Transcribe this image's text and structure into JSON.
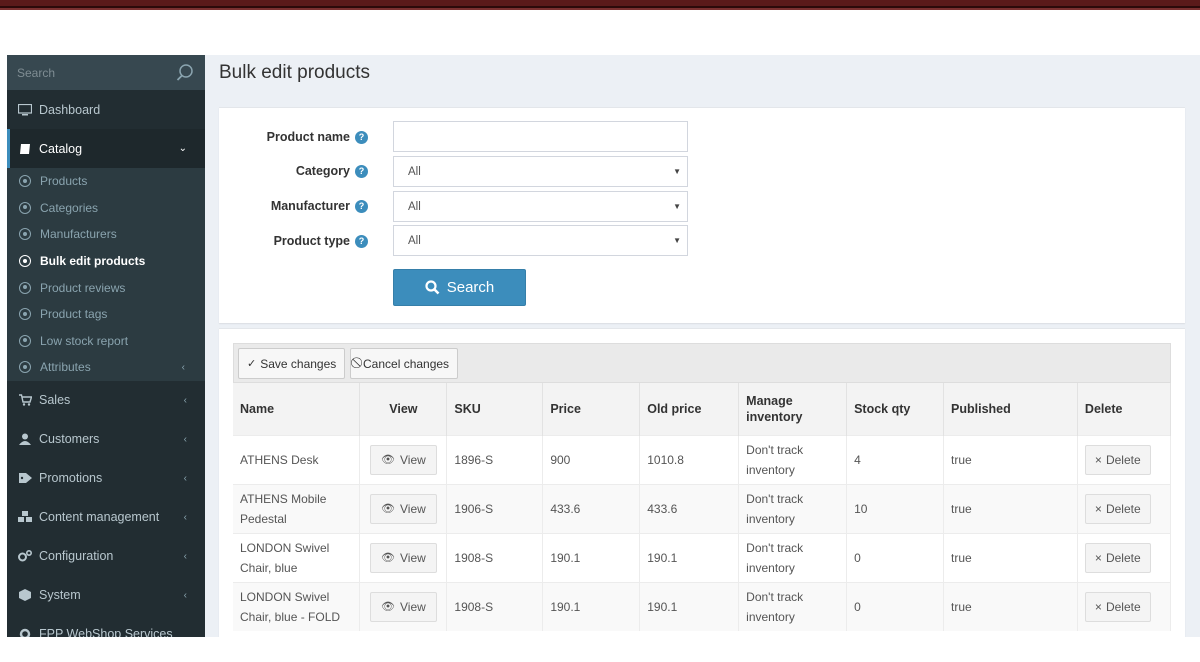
{
  "sidebar": {
    "search_placeholder": "Search",
    "items": [
      {
        "label": "Dashboard"
      },
      {
        "label": "Catalog"
      },
      {
        "label": "Sales"
      },
      {
        "label": "Customers"
      },
      {
        "label": "Promotions"
      },
      {
        "label": "Content management"
      },
      {
        "label": "Configuration"
      },
      {
        "label": "System"
      },
      {
        "label": "FPP WebShop Services"
      }
    ],
    "catalog_sub": [
      {
        "label": "Products"
      },
      {
        "label": "Categories"
      },
      {
        "label": "Manufacturers"
      },
      {
        "label": "Bulk edit products"
      },
      {
        "label": "Product reviews"
      },
      {
        "label": "Product tags"
      },
      {
        "label": "Low stock report"
      },
      {
        "label": "Attributes"
      }
    ]
  },
  "page": {
    "title": "Bulk edit products"
  },
  "search_form": {
    "product_name_label": "Product name",
    "product_name_value": "",
    "category_label": "Category",
    "category_value": "All",
    "manufacturer_label": "Manufacturer",
    "manufacturer_value": "All",
    "product_type_label": "Product type",
    "product_type_value": "All",
    "search_button": "Search"
  },
  "grid": {
    "save_label": "Save changes",
    "cancel_label": "Cancel changes",
    "columns": [
      "Name",
      "View",
      "SKU",
      "Price",
      "Old price",
      "Manage inventory",
      "Stock qty",
      "Published",
      "Delete"
    ],
    "view_label": "View",
    "delete_label": "Delete",
    "rows": [
      {
        "name": "ATHENS Desk",
        "sku": "1896-S",
        "price": "900",
        "old_price": "1010.8",
        "inventory": "Don't track inventory",
        "stock": "4",
        "published": "true"
      },
      {
        "name": "ATHENS Mobile Pedestal",
        "sku": "1906-S",
        "price": "433.6",
        "old_price": "433.6",
        "inventory": "Don't track inventory",
        "stock": "10",
        "published": "true"
      },
      {
        "name": "LONDON Swivel Chair, blue",
        "sku": "1908-S",
        "price": "190.1",
        "old_price": "190.1",
        "inventory": "Don't track inventory",
        "stock": "0",
        "published": "true"
      },
      {
        "name": "LONDON Swivel Chair, blue - FOLD",
        "sku": "1908-S",
        "price": "190.1",
        "old_price": "190.1",
        "inventory": "Don't track inventory",
        "stock": "0",
        "published": "true"
      }
    ]
  },
  "colors": {
    "sidebar_bg": "#222d32",
    "accent": "#3c8dbc",
    "content_bg": "#ecf0f5"
  }
}
